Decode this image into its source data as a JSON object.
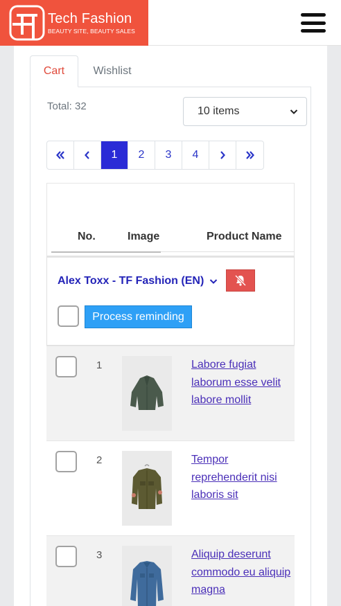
{
  "brand": {
    "title": "Tech Fashion",
    "tagline": "BEAUTY SITE, BEAUTY SALES",
    "color": "#f0533d"
  },
  "tabs": [
    {
      "label": "Cart",
      "active": true
    },
    {
      "label": "Wishlist",
      "active": false
    }
  ],
  "summary": {
    "total": "Total: 32",
    "page_size": "10 items"
  },
  "pagination": {
    "first": "«",
    "prev": "‹",
    "pages": [
      "1",
      "2",
      "3",
      "4"
    ],
    "current": "1",
    "next": "›",
    "last": "»"
  },
  "table": {
    "headers": {
      "no": "No.",
      "image": "Image",
      "name": "Product Name"
    }
  },
  "group": {
    "name": "Alex Toxx - TF Fashion (EN)",
    "process_label": "Process reminding",
    "mute_icon": "bell-slash-icon"
  },
  "rows": [
    {
      "no": "1",
      "name": "Labore fugiat laborum esse velit labore mollit",
      "image": "green-poncho-jacket"
    },
    {
      "no": "2",
      "name": "Tempor reprehenderit nisi laboris sit",
      "image": "olive-field-jacket"
    },
    {
      "no": "3",
      "name": "Aliquip deserunt commodo eu aliquip magna",
      "image": "denim-shirt"
    }
  ],
  "colors": {
    "accent": "#e0493a",
    "pagination_active": "#2a2bd6",
    "link": "#4a2fb8",
    "process_button": "#2ea0f6",
    "mute_button": "#e35350"
  }
}
